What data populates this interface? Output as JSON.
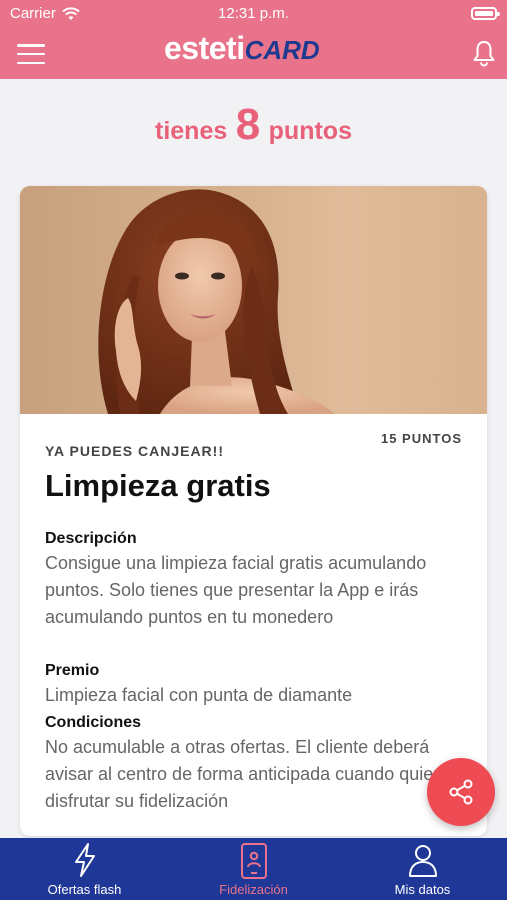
{
  "status_bar": {
    "carrier": "Carrier",
    "time": "12:31 p.m."
  },
  "header": {
    "logo_part1": "esteti",
    "logo_part2": "CARD",
    "menu_icon": "hamburger-icon",
    "notification_icon": "bell-icon"
  },
  "points": {
    "prefix": "tienes",
    "value": "8",
    "suffix": "puntos"
  },
  "offer": {
    "status": "YA PUEDES CANJEAR!!",
    "cost": "15 PUNTOS",
    "title": "Limpieza gratis",
    "description_label": "Descripción",
    "description": "Consigue una limpieza facial gratis acumulando puntos. Solo tienes que presentar la App e irás acumulando puntos en tu monedero",
    "prize_label": "Premio",
    "prize": "Limpieza facial con punta de diamante",
    "conditions_label": "Condiciones",
    "conditions": "No acumulable a otras ofertas. El cliente deberá avisar al centro de forma anticipada cuando quiere disfrutar su fidelización"
  },
  "share_icon": "share-icon",
  "tabs": [
    {
      "label": "Ofertas flash",
      "icon": "lightning-icon",
      "active": false
    },
    {
      "label": "Fidelización",
      "icon": "phone-badge-icon",
      "active": true
    },
    {
      "label": "Mis datos",
      "icon": "user-icon",
      "active": false
    }
  ],
  "colors": {
    "header": "#e9738a",
    "points_text": "#e9607a",
    "tabbar": "#1f3796",
    "fab": "#ef4b55",
    "logo_accent": "#1d3a8f"
  }
}
